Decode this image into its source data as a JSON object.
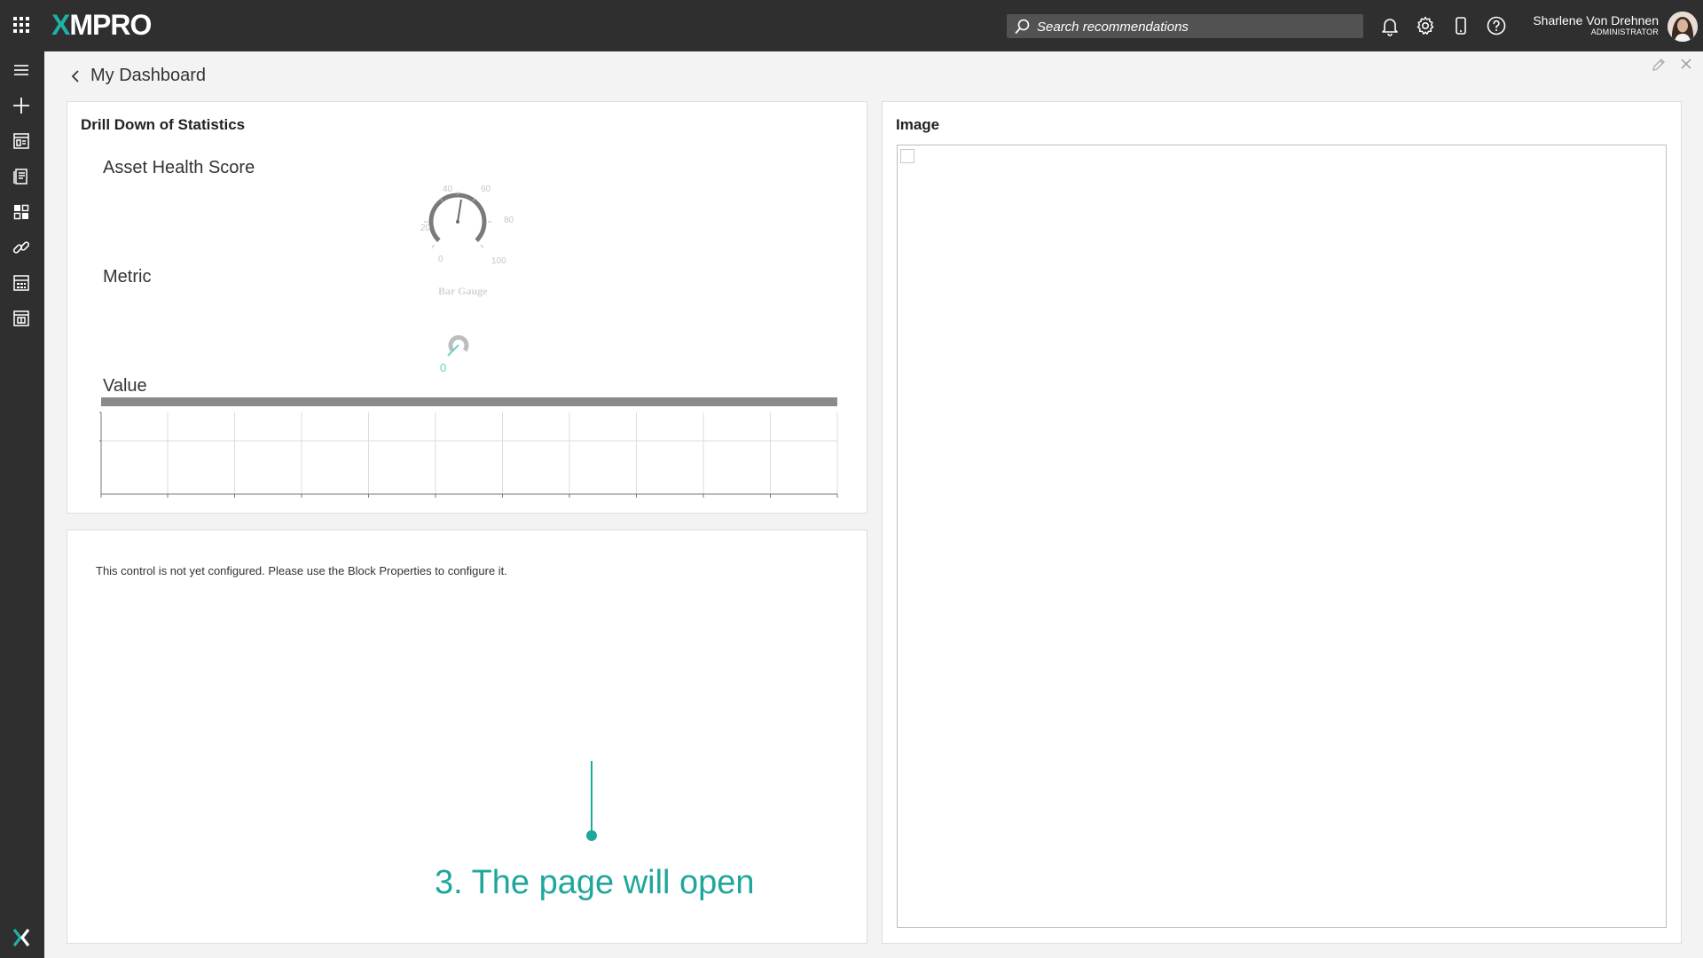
{
  "app": {
    "brand_x": "X",
    "brand_rest": "MPRO"
  },
  "search": {
    "placeholder": "Search recommendations"
  },
  "user": {
    "name": "Sharlene Von Drehnen",
    "role": "ADMINISTRATOR"
  },
  "icons": {
    "apps": "apps-grid-icon",
    "notifications": "bell-icon",
    "settings": "gear-icon",
    "mobile": "mobile-icon",
    "help": "help-icon"
  },
  "sidebar": {
    "items": [
      {
        "icon": "menu-icon"
      },
      {
        "icon": "plus-icon"
      },
      {
        "icon": "dashboard-icon"
      },
      {
        "icon": "recommendation-icon"
      },
      {
        "icon": "widgets-icon"
      },
      {
        "icon": "link-icon"
      },
      {
        "icon": "calculator-icon"
      },
      {
        "icon": "template-icon"
      }
    ]
  },
  "page": {
    "title": "My Dashboard"
  },
  "drilldown": {
    "title": "Drill Down of Statistics",
    "labels": {
      "score": "Asset Health Score",
      "metric": "Metric",
      "value": "Value"
    },
    "gauge": {
      "ticks": [
        "0",
        "20",
        "40",
        "60",
        "80",
        "100"
      ],
      "caption": "Bar Gauge",
      "value_shown": "0"
    }
  },
  "unconfigured": {
    "message": "This control is not yet configured. Please use the Block Properties to configure it."
  },
  "image_panel": {
    "title": "Image"
  },
  "callout": {
    "text": "3. The page will open"
  },
  "colors": {
    "accent": "#1fa79b",
    "bar": "#2f2f2f",
    "background": "#f3f3f3"
  }
}
